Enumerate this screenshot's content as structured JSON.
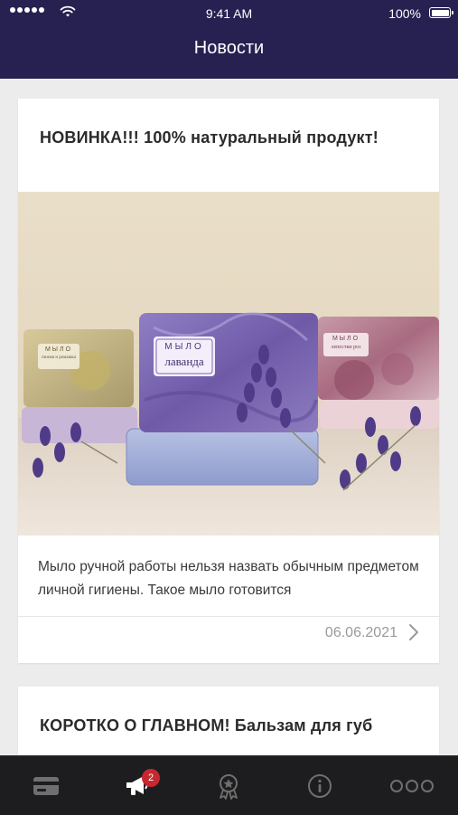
{
  "status_bar": {
    "time": "9:41 AM",
    "battery": "100%",
    "icons": [
      "signal-dots-icon",
      "wifi-icon",
      "battery-icon"
    ]
  },
  "nav": {
    "title": "Новости"
  },
  "feed": {
    "items": [
      {
        "title": "НОВИНКА!!! 100% натуральный продукт!",
        "image": {
          "soaps": [
            {
              "label_top": "МЫЛО",
              "label_bottom": "лаванда"
            },
            {
              "label_top": "МЫЛО",
              "label_bottom": "лепестки роз"
            },
            {
              "label_top": "МЫЛО",
              "label_bottom": "пижма и ромашка"
            }
          ]
        },
        "text": "Мыло ручной работы нельзя назвать обычным предметом личной гигиены. Такое мыло готовится",
        "date": "06.06.2021"
      },
      {
        "title": "КОРОТКО О ГЛАВНОМ! Бальзам для губ"
      }
    ]
  },
  "tab_bar": {
    "tabs": [
      {
        "name": "card",
        "icon": "card-icon"
      },
      {
        "name": "news",
        "icon": "megaphone-icon",
        "badge": "2"
      },
      {
        "name": "rewards",
        "icon": "award-icon"
      },
      {
        "name": "info",
        "icon": "info-icon"
      },
      {
        "name": "more",
        "icon": "more-icon"
      }
    ]
  },
  "colors": {
    "header_bg": "#272152",
    "tab_bar_bg": "#1d1d1f",
    "badge_bg": "#c7282f",
    "page_bg": "#ececec"
  }
}
